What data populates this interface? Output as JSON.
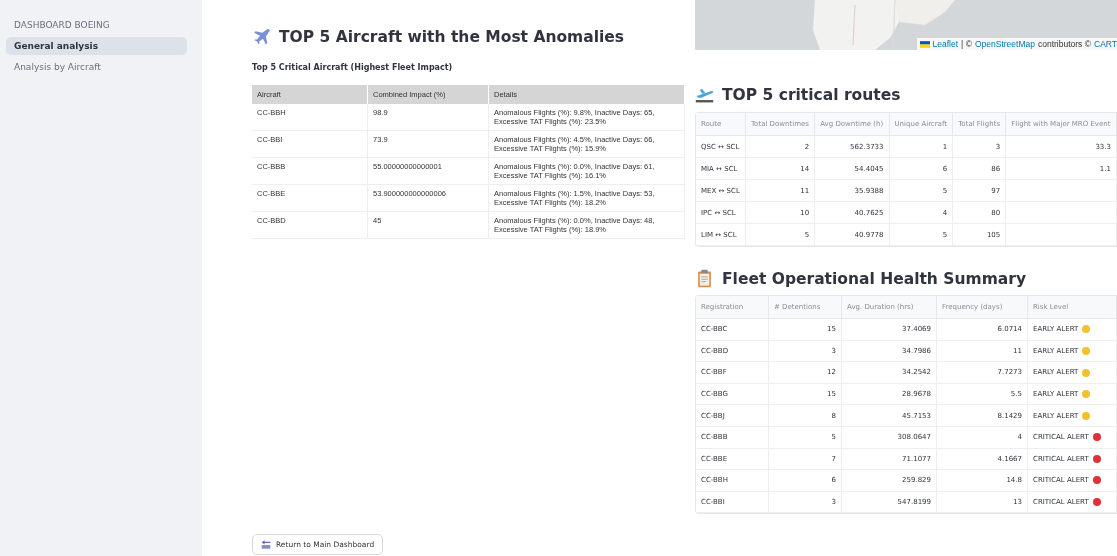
{
  "sidebar": {
    "title": "DASHBOARD BOEING",
    "items": [
      {
        "label": "General analysis",
        "selected": true
      },
      {
        "label": "Analysis by Aircraft",
        "selected": false
      }
    ]
  },
  "anomalies": {
    "title": "TOP 5 Aircraft with the Most Anomalies",
    "subtitle": "Top 5 Critical Aircraft (Highest Fleet Impact)",
    "columns": [
      "Aircraft",
      "Combined Impact (%)",
      "Details"
    ],
    "rows": [
      [
        "CC-BBH",
        "98.9",
        "Anomalous Flights (%): 9.8%, Inactive Days: 65, Excessive TAT Flights (%): 23.5%"
      ],
      [
        "CC-BBI",
        "73.9",
        "Anomalous Flights (%): 4.5%, Inactive Days: 66, Excessive TAT Flights (%): 15.9%"
      ],
      [
        "CC-BBB",
        "55.00000000000001",
        "Anomalous Flights (%): 0.0%, Inactive Days: 61, Excessive TAT Flights (%): 16.1%"
      ],
      [
        "CC-BBE",
        "53.900000000000006",
        "Anomalous Flights (%): 1.5%, Inactive Days: 53, Excessive TAT Flights (%): 18.2%"
      ],
      [
        "CC-BBD",
        "45",
        "Anomalous Flights (%): 0.0%, Inactive Days: 48, Excessive TAT Flights (%): 18.9%"
      ]
    ]
  },
  "return_button": "Return to Main Dashboard",
  "map": {
    "attribution": {
      "link1": "Leaflet",
      "separator": "| ©",
      "link2": "OpenStreetMap",
      "text": "contributors ©",
      "link3": "CART"
    }
  },
  "routes": {
    "title": "TOP 5 critical routes",
    "columns": [
      "Route",
      "Total Downtimes",
      "Avg Downtime (h)",
      "Unique Aircraft",
      "Total Flights",
      "Flight with Major MRO Event"
    ],
    "rows": [
      [
        "QSC ↔ SCL",
        "2",
        "562.3733",
        "1",
        "3",
        "33.3"
      ],
      [
        "MIA ↔ SCL",
        "14",
        "54.4045",
        "6",
        "86",
        "1.1"
      ],
      [
        "MEX ↔ SCL",
        "11",
        "35.9388",
        "5",
        "97",
        ""
      ],
      [
        "IPC ↔ SCL",
        "10",
        "40.7625",
        "4",
        "80",
        ""
      ],
      [
        "LIM ↔ SCL",
        "5",
        "40.9778",
        "5",
        "105",
        ""
      ]
    ]
  },
  "health": {
    "title": "Fleet Operational Health Summary",
    "columns": [
      "Registration",
      "# Detentions",
      "Avg. Duration (hrs)",
      "Frequency (days)",
      "Risk Level"
    ],
    "rows": [
      {
        "cells": [
          "CC-BBC",
          "15",
          "37.4069",
          "6.0714"
        ],
        "risk": "EARLY ALERT",
        "color": "#f2c12e"
      },
      {
        "cells": [
          "CC-BBD",
          "3",
          "34.7986",
          "11"
        ],
        "risk": "EARLY ALERT",
        "color": "#f2c12e"
      },
      {
        "cells": [
          "CC-BBF",
          "12",
          "34.2542",
          "7.7273"
        ],
        "risk": "EARLY ALERT",
        "color": "#f2c12e"
      },
      {
        "cells": [
          "CC-BBG",
          "15",
          "28.9678",
          "5.5"
        ],
        "risk": "EARLY ALERT",
        "color": "#f2c12e"
      },
      {
        "cells": [
          "CC-BBJ",
          "8",
          "45.7153",
          "8.1429"
        ],
        "risk": "EARLY ALERT",
        "color": "#f2c12e"
      },
      {
        "cells": [
          "CC-BBB",
          "5",
          "308.0647",
          "4"
        ],
        "risk": "CRITICAL ALERT",
        "color": "#e0303a"
      },
      {
        "cells": [
          "CC-BBE",
          "7",
          "71.1077",
          "4.1667"
        ],
        "risk": "CRITICAL ALERT",
        "color": "#e0303a"
      },
      {
        "cells": [
          "CC-BBH",
          "6",
          "259.829",
          "14.8"
        ],
        "risk": "CRITICAL ALERT",
        "color": "#e0303a"
      },
      {
        "cells": [
          "CC-BBI",
          "3",
          "547.8199",
          "13"
        ],
        "risk": "CRITICAL ALERT",
        "color": "#e0303a"
      }
    ]
  }
}
